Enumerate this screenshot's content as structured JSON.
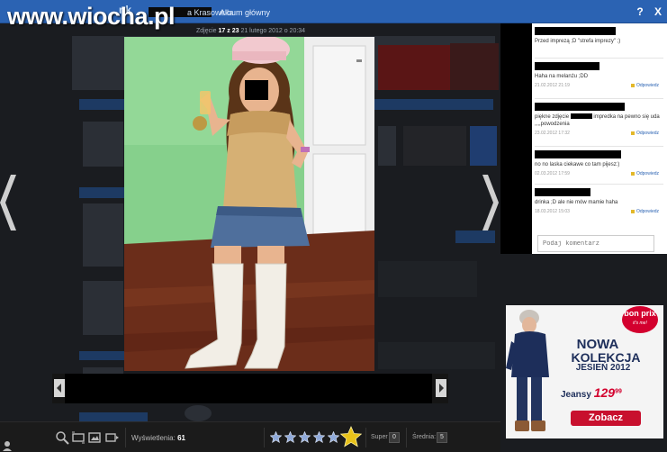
{
  "watermark": {
    "text": "www.wiocha.pl"
  },
  "topbar": {
    "logo": "nk",
    "user_tail": "a Krasowska",
    "album_link": "Album główny",
    "help_label": "?",
    "close_label": "X"
  },
  "photo_info": {
    "prefix": "Zdjęcie",
    "counter": "17 z 23",
    "date": "21 lutego 2012 o 20:34"
  },
  "comments": [
    {
      "text": "Przed imprezą ;D \"strefa imprezy\" ;)",
      "date": "",
      "reply": ""
    },
    {
      "text": "Haha na melanżu ;DD",
      "date": "21.02.2012 21:19",
      "reply": "Odpowiedz"
    },
    {
      "text_before": "piękne zdjęcie",
      "text_after": "impredka na pewno się uda ,,,,powodzenia",
      "date": "23.02.2012 17:32",
      "reply": "Odpowiedz"
    },
    {
      "text": "no no laska ciekawe co tam pijesz:)",
      "date": "02.03.2012 17:59",
      "reply": "Odpowiedz"
    },
    {
      "text": "drinka ;D ale nie mów mamie haha",
      "date": "18.03.2012 15:03",
      "reply": "Odpowiedz"
    }
  ],
  "comment_input": {
    "placeholder": "Podaj komentarz"
  },
  "toolbar": {
    "views_label": "Wyświetlenia:",
    "views_value": "61",
    "super_label": "Super",
    "super_count": "0",
    "avg_label": "Średnia:",
    "avg_value": "5",
    "rating_stars": 5,
    "rating_max": 5
  },
  "ad": {
    "brand": "bon prix",
    "brand_tag": "it's me!",
    "title1": "NOWA",
    "title2": "KOLEKCJA",
    "title3": "JESIEŃ 2012",
    "price_label": "Jeansy",
    "price_value": "129",
    "price_cents": "99",
    "cta": "Zobacz"
  },
  "colors": {
    "topbar": "#2b63b3",
    "accent_red": "#c8102e",
    "star_gold": "#e8c21a",
    "star_blue": "#8fa9d9"
  },
  "icons": [
    "search-zoom-icon",
    "fullscreen-icon",
    "edit-photo-icon",
    "slideshow-icon",
    "chevron-left-icon",
    "chevron-right-icon",
    "user-corner-icon"
  ]
}
